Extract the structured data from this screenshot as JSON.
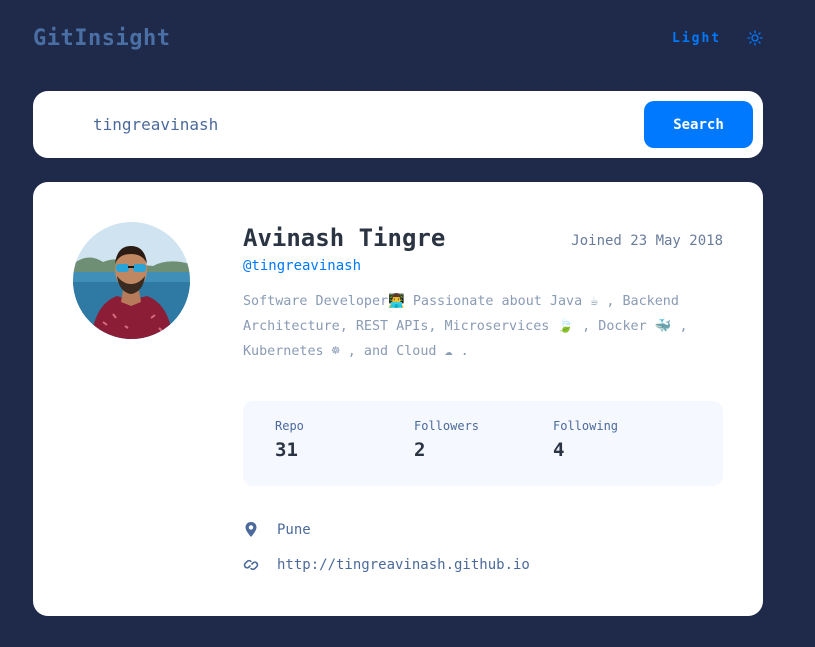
{
  "app": {
    "title": "GitInsight"
  },
  "header": {
    "theme_label": "Light",
    "theme_icon": "sun-icon"
  },
  "search": {
    "value": "tingreavinash",
    "button_label": "Search"
  },
  "profile": {
    "name": "Avinash Tingre",
    "username": "@tingreavinash",
    "joined": "Joined 23 May 2018",
    "bio": "Software Developer👨‍💻 Passionate about Java ☕ , Backend Architecture, REST APIs, Microservices 🍃 , Docker 🐳 , Kubernetes ☸ , and Cloud ☁ ."
  },
  "stats": {
    "repo_label": "Repo",
    "repo_value": "31",
    "followers_label": "Followers",
    "followers_value": "2",
    "following_label": "Following",
    "following_value": "4"
  },
  "info": {
    "location": "Pune",
    "website": "http://tingreavinash.github.io",
    "location_icon": "location-pin-icon",
    "website_icon": "link-icon"
  },
  "colors": {
    "background": "#1f2a4a",
    "accent": "#0079ff",
    "card": "#ffffff",
    "stats_bg": "#f6f8ff",
    "heading": "#2b3442",
    "body_text": "#4b6a9b"
  }
}
